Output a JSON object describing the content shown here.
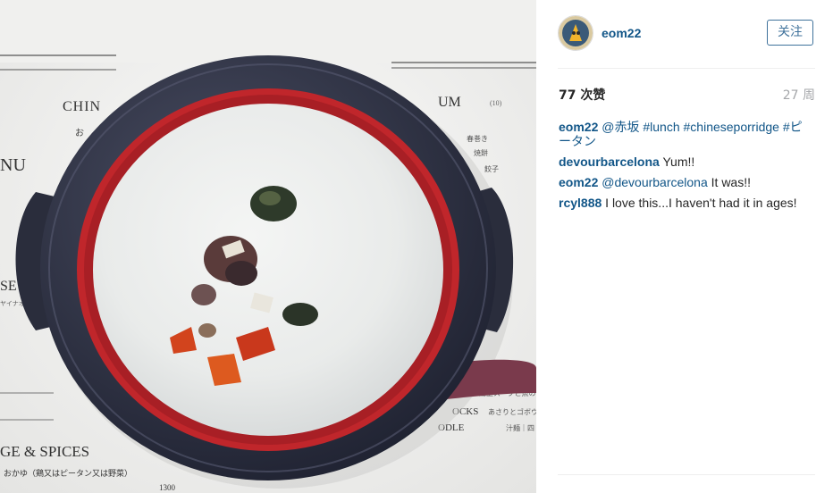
{
  "post": {
    "username": "eom22",
    "follow_label": "关注",
    "likes": "77 次赞",
    "time_ago": "27 周"
  },
  "photo": {
    "menu_texts": {
      "chinese_partial": "CHIN",
      "um_partial": "UM",
      "nu_partial": "NU",
      "se_partial": "SE",
      "spices": "GE & SPICES",
      "okayu": "おかゆ（鶏又はピータン又は野菜）",
      "price": "1300",
      "stocks": "OCKS",
      "odle": "ODLE",
      "small_o": "お",
      "kana_1": "春巻き",
      "kana_2": "焼餅",
      "kana_3": "餃子",
      "kana_4": "湯上スープと魚の",
      "kana_5": "あさりとゴボウ",
      "kana_6": "汁麺｜四",
      "kana_7": "ヤイナオ",
      "num_side": "(10)"
    }
  },
  "comments": [
    {
      "user": "eom22",
      "parts": [
        {
          "t": "text",
          "v": " "
        },
        {
          "t": "link",
          "v": "@赤坂"
        },
        {
          "t": "text",
          "v": " "
        },
        {
          "t": "link",
          "v": "#lunch"
        },
        {
          "t": "text",
          "v": " "
        },
        {
          "t": "link",
          "v": "#chineseporridge"
        },
        {
          "t": "text",
          "v": " "
        },
        {
          "t": "link",
          "v": "#ピータン"
        }
      ]
    },
    {
      "user": "devourbarcelona",
      "parts": [
        {
          "t": "text",
          "v": " Yum!!"
        }
      ]
    },
    {
      "user": "eom22",
      "parts": [
        {
          "t": "text",
          "v": " "
        },
        {
          "t": "link",
          "v": "@devourbarcelona"
        },
        {
          "t": "text",
          "v": " It was!!"
        }
      ]
    },
    {
      "user": "rcyl888",
      "parts": [
        {
          "t": "text",
          "v": " I love this...I haven't had it in ages!"
        }
      ]
    }
  ]
}
